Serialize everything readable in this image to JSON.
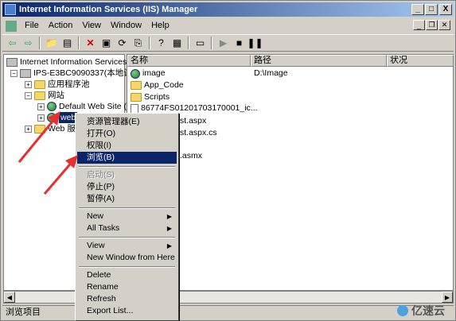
{
  "window": {
    "title": "Internet Information Services (IIS) Manager",
    "min": "_",
    "max": "□",
    "close": "X"
  },
  "menubar": {
    "items": [
      "File",
      "Action",
      "View",
      "Window",
      "Help"
    ]
  },
  "tree": {
    "root": "Internet Information Services",
    "computer": "IPS-E3BC9090337(本地计算机)",
    "app_pools": "应用程序池",
    "websites": "网站",
    "default_site": "Default Web Site (停止)",
    "selected_site": "web",
    "web_service": "Web 服务扩展"
  },
  "list": {
    "headers": [
      "名称",
      "路径",
      "状况"
    ],
    "rows": [
      {
        "name": "image",
        "path": "D:\\Image",
        "icon": "globe-icon"
      },
      {
        "name": "App_Code",
        "path": "",
        "icon": "folder-icon"
      },
      {
        "name": "Scripts",
        "path": "",
        "icon": "folder-icon"
      },
      {
        "name": "86774FS01201703170001_ic...",
        "path": "",
        "icon": "file-icon"
      },
      {
        "name": "st.aspx",
        "path": "",
        "icon": "file-icon"
      },
      {
        "name": "st.aspx.cs",
        "path": "",
        "icon": "file-icon"
      },
      {
        "name": ".asmx",
        "path": "",
        "icon": "file-icon"
      }
    ]
  },
  "context_menu": {
    "items": [
      {
        "label": "资源管理器(E)",
        "state": "normal"
      },
      {
        "label": "打开(O)",
        "state": "normal"
      },
      {
        "label": "权限(I)",
        "state": "normal"
      },
      {
        "label": "浏览(B)",
        "state": "selected"
      },
      {
        "label": "启动(S)",
        "state": "disabled"
      },
      {
        "label": "停止(P)",
        "state": "normal"
      },
      {
        "label": "暂停(A)",
        "state": "normal"
      },
      {
        "label": "New",
        "state": "submenu"
      },
      {
        "label": "All Tasks",
        "state": "submenu"
      },
      {
        "label": "View",
        "state": "submenu"
      },
      {
        "label": "New Window from Here",
        "state": "normal"
      },
      {
        "label": "Delete",
        "state": "normal"
      },
      {
        "label": "Rename",
        "state": "normal"
      },
      {
        "label": "Refresh",
        "state": "normal"
      },
      {
        "label": "Export List...",
        "state": "normal"
      }
    ]
  },
  "status": {
    "text": "浏览项目"
  },
  "watermark": {
    "text": "亿速云"
  },
  "colors": {
    "titlebar": "#0a246a",
    "selection": "#0a246a",
    "arrow": "#e53030"
  }
}
